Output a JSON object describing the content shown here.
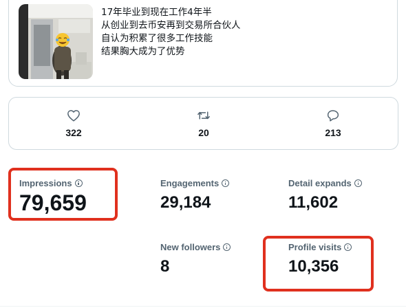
{
  "tweet": {
    "lines": [
      "17年毕业到现在工作4年半",
      "从创业到去币安再到交易所合伙人",
      "自认为积累了很多工作技能",
      "结果胸大成为了优势"
    ]
  },
  "engagement": {
    "likes": "322",
    "retweets": "20",
    "replies": "213"
  },
  "metrics": {
    "impressions": {
      "label": "Impressions",
      "value": "79,659"
    },
    "engagements": {
      "label": "Engagements",
      "value": "29,184"
    },
    "detail_expands": {
      "label": "Detail expands",
      "value": "11,602"
    },
    "new_followers": {
      "label": "New followers",
      "value": "8"
    },
    "profile_visits": {
      "label": "Profile visits",
      "value": "10,356"
    }
  },
  "colors": {
    "highlight": "#e0301e",
    "border": "#cfd9de",
    "muted_text": "#536471"
  }
}
